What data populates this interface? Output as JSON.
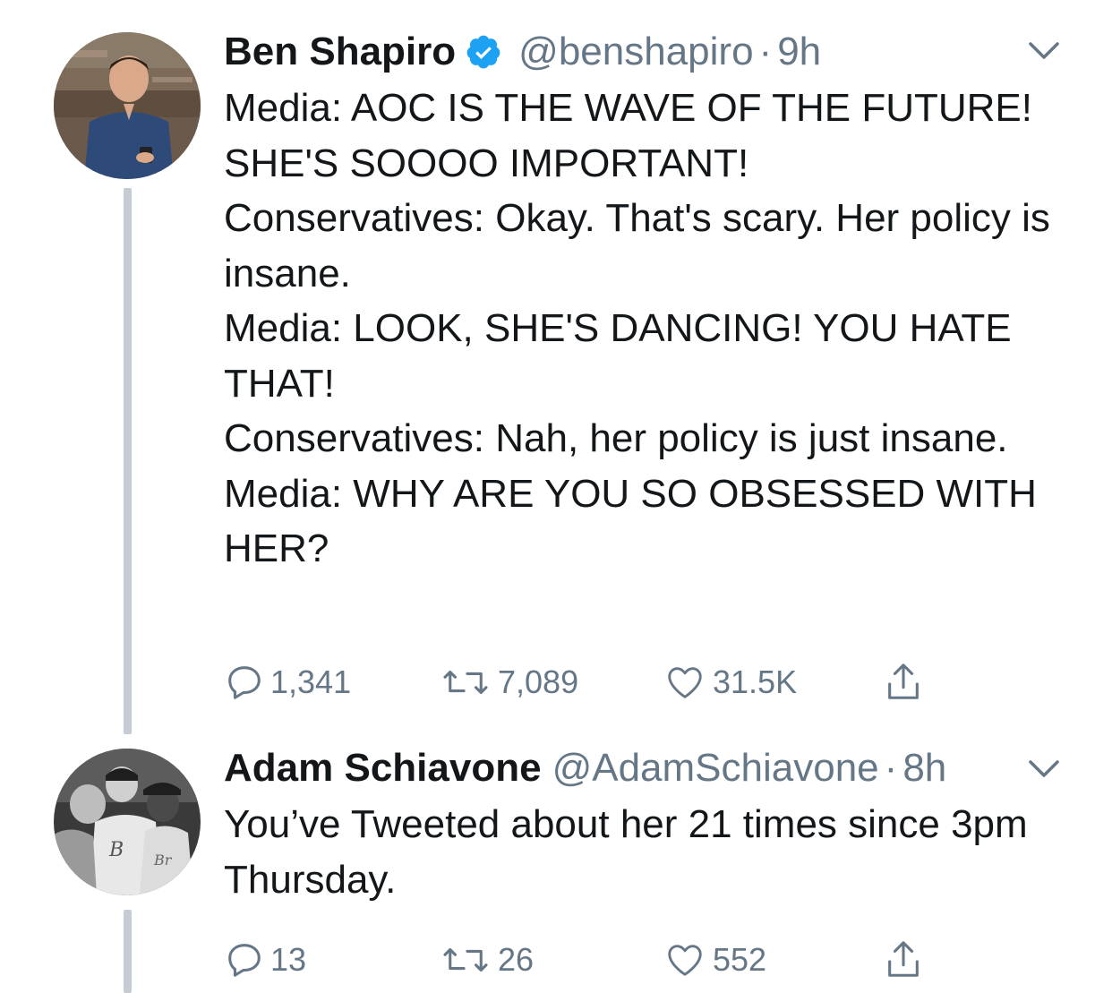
{
  "tweets": [
    {
      "author_name": "Ben Shapiro",
      "verified": true,
      "handle": "@benshapiro",
      "separator": "·",
      "time": "9h",
      "text": "Media: AOC IS THE WAVE OF THE FUTURE! SHE'S SOOOO IMPORTANT!\nConservatives: Okay. That's scary. Her policy is insane.\nMedia: LOOK, SHE'S DANCING! YOU HATE THAT!\nConservatives: Nah, her policy is just insane.\nMedia: WHY ARE YOU SO OBSESSED WITH HER?",
      "replies": "1,341",
      "retweets": "7,089",
      "likes": "31.5K"
    },
    {
      "author_name": "Adam Schiavone",
      "verified": false,
      "handle": "@AdamSchiavone",
      "separator": "·",
      "time": "8h",
      "text": "You’ve Tweeted about her 21 times since 3pm Thursday.",
      "replies": "13",
      "retweets": "26",
      "likes": "552"
    }
  ],
  "icons": {
    "reply": "reply-icon",
    "retweet": "retweet-icon",
    "like": "heart-icon",
    "share": "share-icon",
    "more": "chevron-down-icon",
    "verified": "verified-badge-icon"
  },
  "colors": {
    "text": "#14171a",
    "secondary": "#657786",
    "verified": "#1da1f2",
    "thread_line": "#c5ccd3"
  }
}
